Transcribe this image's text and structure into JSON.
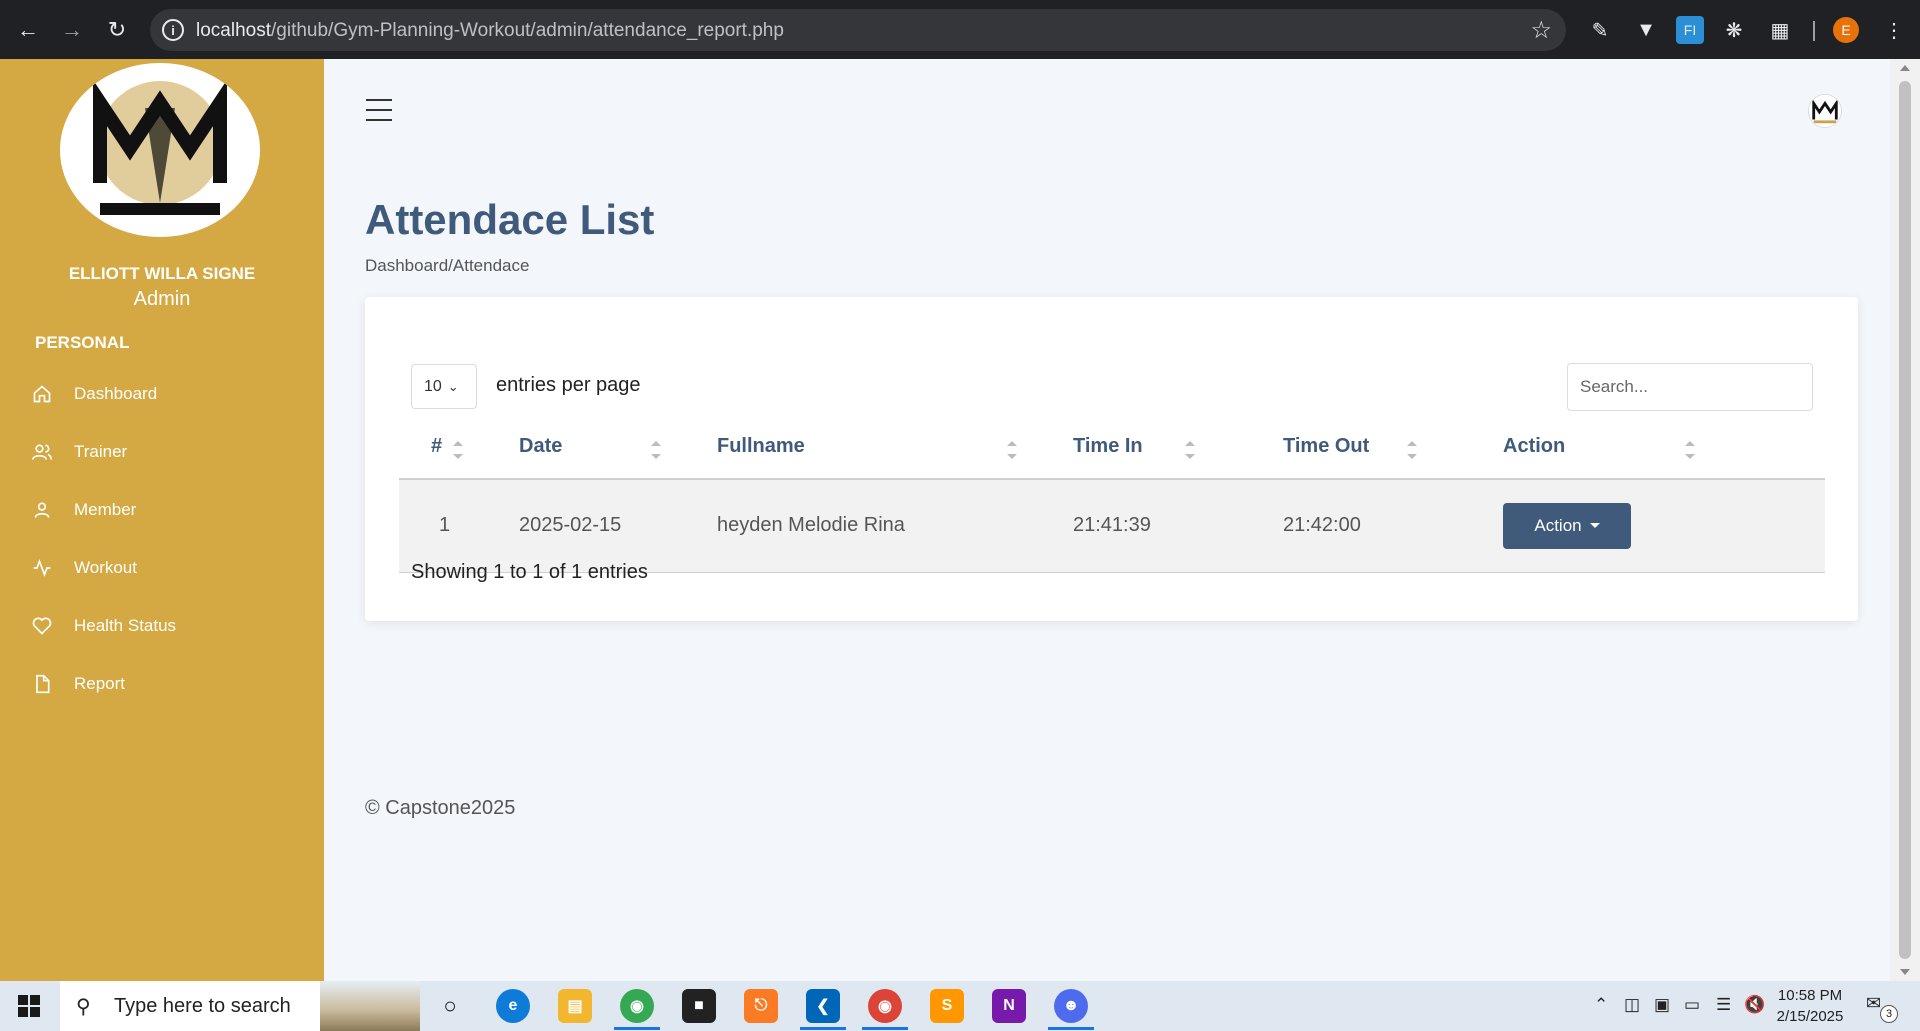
{
  "browser": {
    "url_host": "localhost",
    "url_path": "/github/Gym-Planning-Workout/admin/attendance_report.php",
    "profile_initial": "E"
  },
  "sidebar": {
    "user_name": "ELLIOTT WILLA SIGNE",
    "user_role": "Admin",
    "section_title": "PERSONAL",
    "items": [
      {
        "label": "Dashboard",
        "icon": "home-icon"
      },
      {
        "label": "Trainer",
        "icon": "users-icon"
      },
      {
        "label": "Member",
        "icon": "user-icon"
      },
      {
        "label": "Workout",
        "icon": "activity-icon"
      },
      {
        "label": "Health Status",
        "icon": "heart-icon"
      },
      {
        "label": "Report",
        "icon": "file-icon"
      }
    ],
    "accent_color": "#d4a843"
  },
  "header": {
    "title": "Attendace List",
    "breadcrumb": "Dashboard/Attendace"
  },
  "table_controls": {
    "per_page_value": "10",
    "per_page_label": "entries per page",
    "search_placeholder": "Search..."
  },
  "table": {
    "columns": [
      "#",
      "Date",
      "Fullname",
      "Time In",
      "Time Out",
      "Action"
    ],
    "rows": [
      {
        "num": "1",
        "date": "2025-02-15",
        "fullname": "heyden Melodie Rina",
        "time_in": "21:41:39",
        "time_out": "21:42:00",
        "action_label": "Action"
      }
    ],
    "button_color": "#3f5a7a"
  },
  "summary": "Showing 1 to 1 of 1 entries",
  "footer": "© Capstone2025",
  "taskbar": {
    "search_placeholder": "Type here to search",
    "time": "10:58 PM",
    "date": "2/15/2025",
    "notification_count": "3"
  }
}
